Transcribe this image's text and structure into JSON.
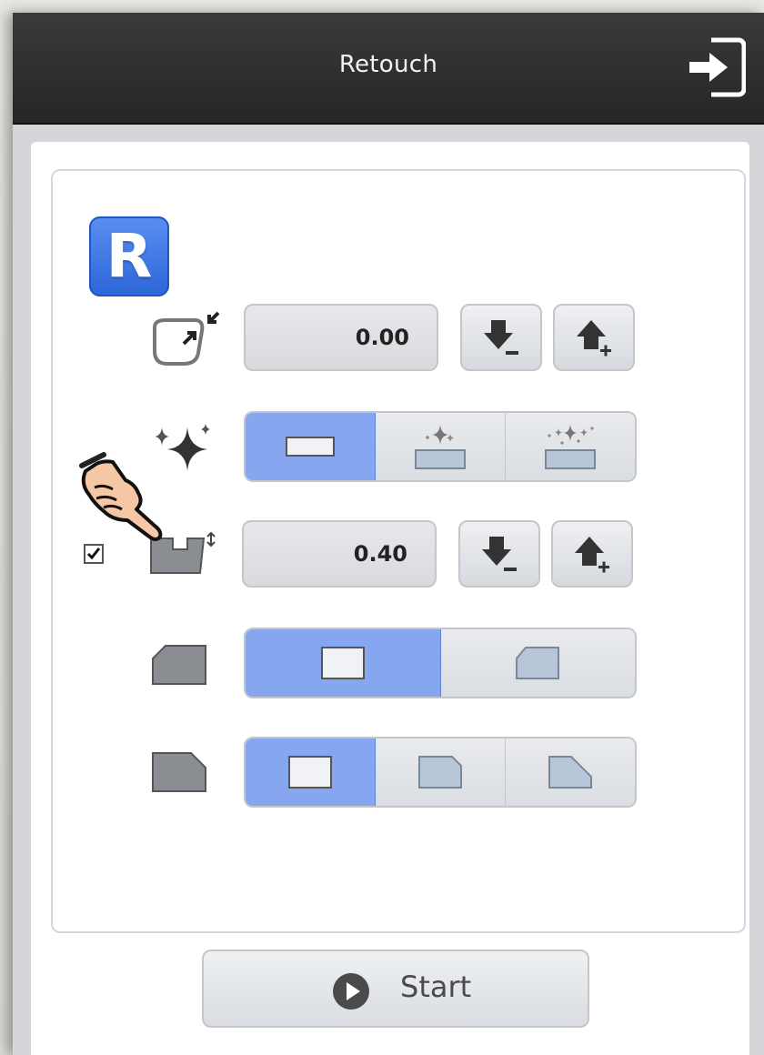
{
  "window": {
    "title": "Retouch",
    "exit_icon": "exit-icon"
  },
  "panel": {
    "logo_letter": "R",
    "rows": [
      {
        "icon": "lens-shrink-icon",
        "value": "0.00",
        "decrease_icon": "arrow-down-minus-icon",
        "increase_icon": "arrow-up-plus-icon"
      },
      {
        "icon": "sparkle-icon",
        "options": [
          "polish-none-icon",
          "polish-light-icon",
          "polish-heavy-icon"
        ],
        "selected_index": 0
      },
      {
        "icon": "groove-depth-icon",
        "checked": true,
        "value": "0.40",
        "decrease_icon": "arrow-down-minus-icon",
        "increase_icon": "arrow-up-plus-icon"
      },
      {
        "icon": "bevel-edge-icon",
        "options": [
          "flat-edge-icon",
          "bevel-edge-option-icon"
        ],
        "selected_index": 0
      },
      {
        "icon": "safety-bevel-icon",
        "options": [
          "no-chamfer-icon",
          "small-chamfer-icon",
          "large-chamfer-icon"
        ],
        "selected_index": 0
      }
    ]
  },
  "start_button": {
    "label": "Start",
    "icon": "play-circle-icon"
  },
  "pointer": {
    "icon": "pointing-hand-icon"
  },
  "colors": {
    "titlebar": "#2e2e2e",
    "accent_blue": "#86a6f0",
    "logo_blue": "#3a74e0"
  }
}
